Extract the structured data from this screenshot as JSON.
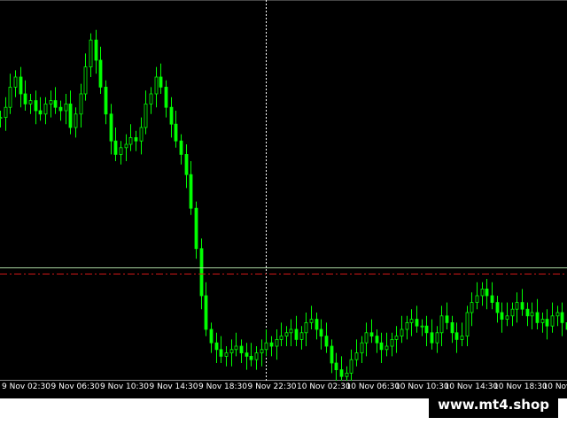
{
  "chart_data": {
    "type": "candlestick",
    "series_color": "#00ff00",
    "crosshair_color": "#ffffff",
    "bid_line_color": "#a9d4a0",
    "ask_line_color": "#d01818",
    "ylim": [
      0,
      100
    ],
    "x_ticks": [
      "9 Nov 02:30",
      "9 Nov 06:30",
      "9 Nov 10:30",
      "9 Nov 14:30",
      "9 Nov 18:30",
      "9 Nov 22:30",
      "10 Nov 02:30",
      "10 Nov 06:30",
      "10 Nov 10:30",
      "10 Nov 14:30",
      "10 Nov 18:30",
      "10 Nov"
    ],
    "closes": [
      73,
      76,
      82,
      85,
      80,
      77,
      78,
      75,
      74,
      77,
      78,
      76,
      75,
      77,
      70,
      74,
      80,
      88,
      96,
      90,
      82,
      74,
      66,
      62,
      64,
      65,
      67,
      66,
      70,
      77,
      80,
      85,
      82,
      76,
      71,
      66,
      62,
      56,
      46,
      34,
      20,
      10,
      6,
      4,
      2,
      3,
      4,
      5,
      3,
      2,
      1,
      3,
      4,
      6,
      5,
      7,
      8,
      9,
      10,
      7,
      9,
      12,
      13,
      10,
      8,
      5,
      0,
      -2,
      -4,
      -3,
      1,
      3,
      6,
      9,
      8,
      6,
      4,
      5,
      7,
      8,
      10,
      12,
      13,
      11,
      11,
      9,
      6,
      9,
      14,
      12,
      9,
      7,
      8,
      15,
      18,
      20,
      22,
      20,
      18,
      15,
      13,
      14,
      16,
      18,
      16,
      14,
      15,
      12,
      13,
      11,
      14,
      15,
      12,
      10
    ]
  },
  "watermark": "www.mt4.shop"
}
